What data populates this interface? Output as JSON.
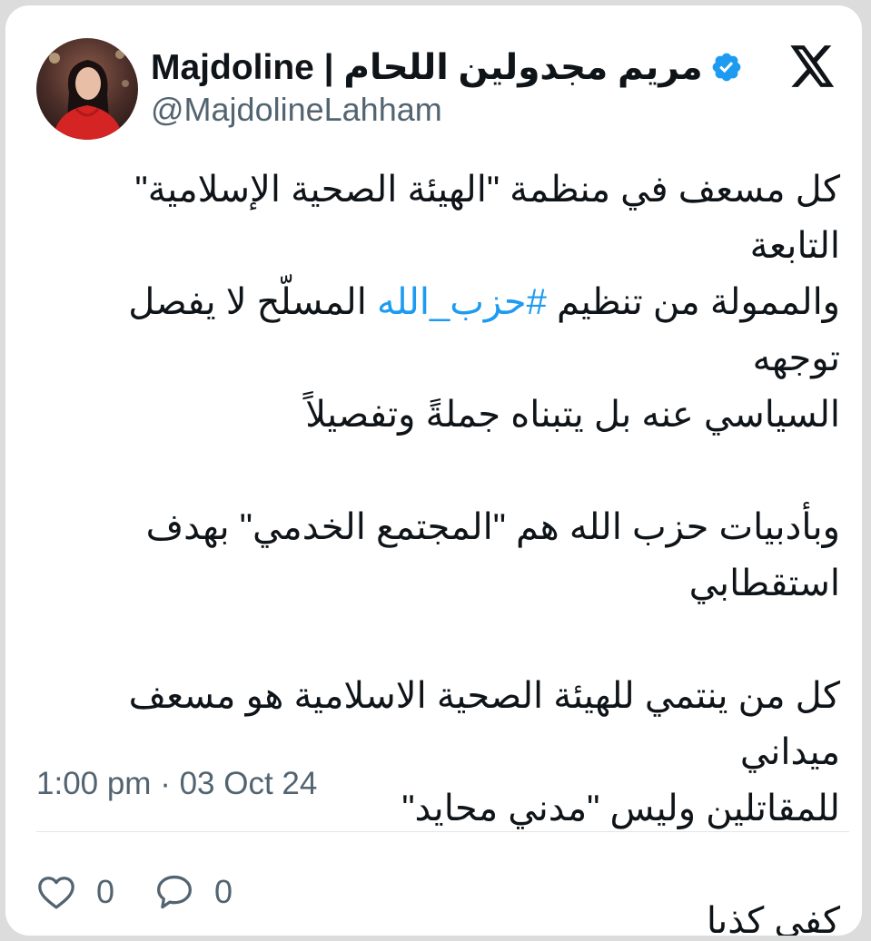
{
  "author": {
    "display_name": "مريم مجدولين اللحام | Majdoline",
    "handle": "@MajdolineLahham",
    "verified": true,
    "avatar_icon": "profile-photo"
  },
  "brand_icon": "x-logo-icon",
  "tweet": {
    "paragraphs": [
      {
        "lines": [
          {
            "parts": [
              {
                "text": "كل مسعف في منظمة \"الهيئة الصحية الإسلامية\" التابعة",
                "hashtag": false
              }
            ]
          },
          {
            "parts": [
              {
                "text": "والممولة من تنظيم ",
                "hashtag": false
              },
              {
                "text": "#حزب_الله",
                "hashtag": true
              },
              {
                "text": " المسلّح لا يفصل توجهه",
                "hashtag": false
              }
            ]
          },
          {
            "parts": [
              {
                "text": "السياسي عنه بل يتبناه جملةً وتفصيلاً",
                "hashtag": false
              }
            ]
          }
        ]
      },
      {
        "lines": [
          {
            "parts": [
              {
                "text": "وبأدبيات حزب الله هم \"المجتمع الخدمي\" بهدف",
                "hashtag": false
              }
            ]
          },
          {
            "parts": [
              {
                "text": "استقطابي",
                "hashtag": false
              }
            ]
          }
        ]
      },
      {
        "lines": [
          {
            "parts": [
              {
                "text": "كل من ينتمي للهيئة الصحية الاسلامية هو مسعف ميداني",
                "hashtag": false
              }
            ]
          },
          {
            "parts": [
              {
                "text": "للمقاتلين وليس \"مدني محايد\"",
                "hashtag": false
              }
            ]
          }
        ]
      },
      {
        "lines": [
          {
            "parts": [
              {
                "text": "كفى كذبا",
                "hashtag": false
              }
            ]
          }
        ]
      }
    ],
    "timestamp": "1:00 pm · 03 Oct 24"
  },
  "actions": {
    "like": {
      "icon": "heart-icon",
      "count": "0"
    },
    "reply": {
      "icon": "comment-icon",
      "count": "0"
    }
  },
  "colors": {
    "hashtag": "#1d9bf0",
    "verified_badge": "#1d9bf0",
    "text_primary": "#0f1419",
    "text_secondary": "#536471"
  }
}
